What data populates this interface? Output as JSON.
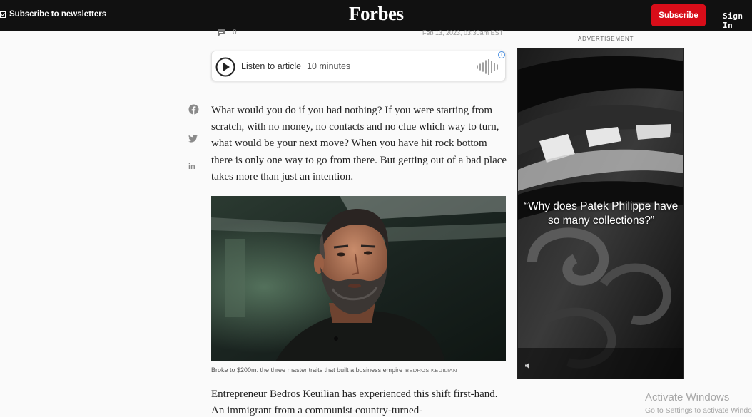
{
  "header": {
    "newsletter_label": "Subscribe to newsletters",
    "logo": "Forbes",
    "subscribe_label": "Subscribe",
    "signin_label": "Sign In",
    "background": "#111111",
    "accent": "#d80d19"
  },
  "meta": {
    "comment_count": "0",
    "date": "Feb 13, 2023, 03:30am EST"
  },
  "listen": {
    "label": "Listen to article",
    "duration": "10 minutes",
    "info_icon": "i"
  },
  "share": {
    "icons": [
      "facebook-icon",
      "twitter-icon",
      "linkedin-icon"
    ],
    "linkedin_text": "in"
  },
  "article": {
    "paragraph1": "What would you do if you had nothing? If you were starting from scratch, with no money, no contacts and no clue which way to turn, what would be your next move? When you have hit rock bottom there is only one way to go from there. But getting out of a bad place takes more than just an intention.",
    "caption": "Broke to $200m: the three master traits that built a business empire",
    "credit": "BEDROS KEUILIAN",
    "paragraph2": "Entrepreneur Bedros Keuilian has experienced this shift first-hand. An immigrant from a communist country-turned-"
  },
  "ad": {
    "label": "ADVERTISEMENT",
    "quote": "“Why does Patek Philippe have so many collections?”"
  },
  "watermark": {
    "line1": "Activate Windows",
    "line2": "Go to Settings to activate Windows."
  }
}
